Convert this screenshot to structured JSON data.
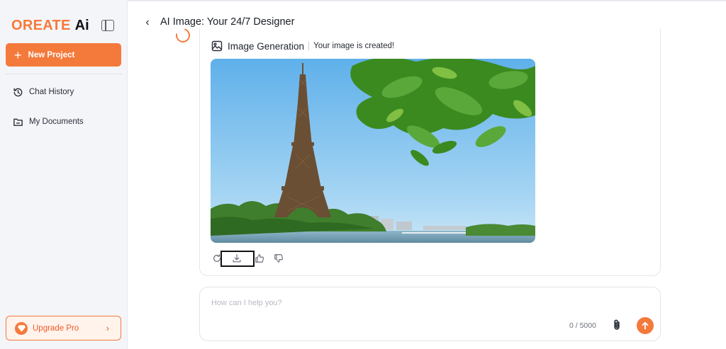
{
  "sidebar": {
    "logo_brand": "OREATE",
    "logo_suffix": "Ai",
    "new_project_label": "New Project",
    "items": [
      {
        "label": "Chat History",
        "icon": "history-icon"
      },
      {
        "label": "My Documents",
        "icon": "folder-icon"
      }
    ],
    "upgrade_label": "Upgrade Pro"
  },
  "header": {
    "title": "AI Image: Your 24/7 Designer"
  },
  "message": {
    "tool_title": "Image Generation",
    "status": "Your image is created!",
    "image_subject": "Eiffel Tower with trees, blue sky and river",
    "actions": [
      "regenerate-icon",
      "download-icon",
      "thumbs-up-icon",
      "thumbs-down-icon"
    ]
  },
  "composer": {
    "placeholder": "How can I help you?",
    "value": "",
    "char_count": "0 / 5000"
  },
  "colors": {
    "accent": "#f47a3c",
    "sidebar_bg": "#f4f5f9"
  }
}
